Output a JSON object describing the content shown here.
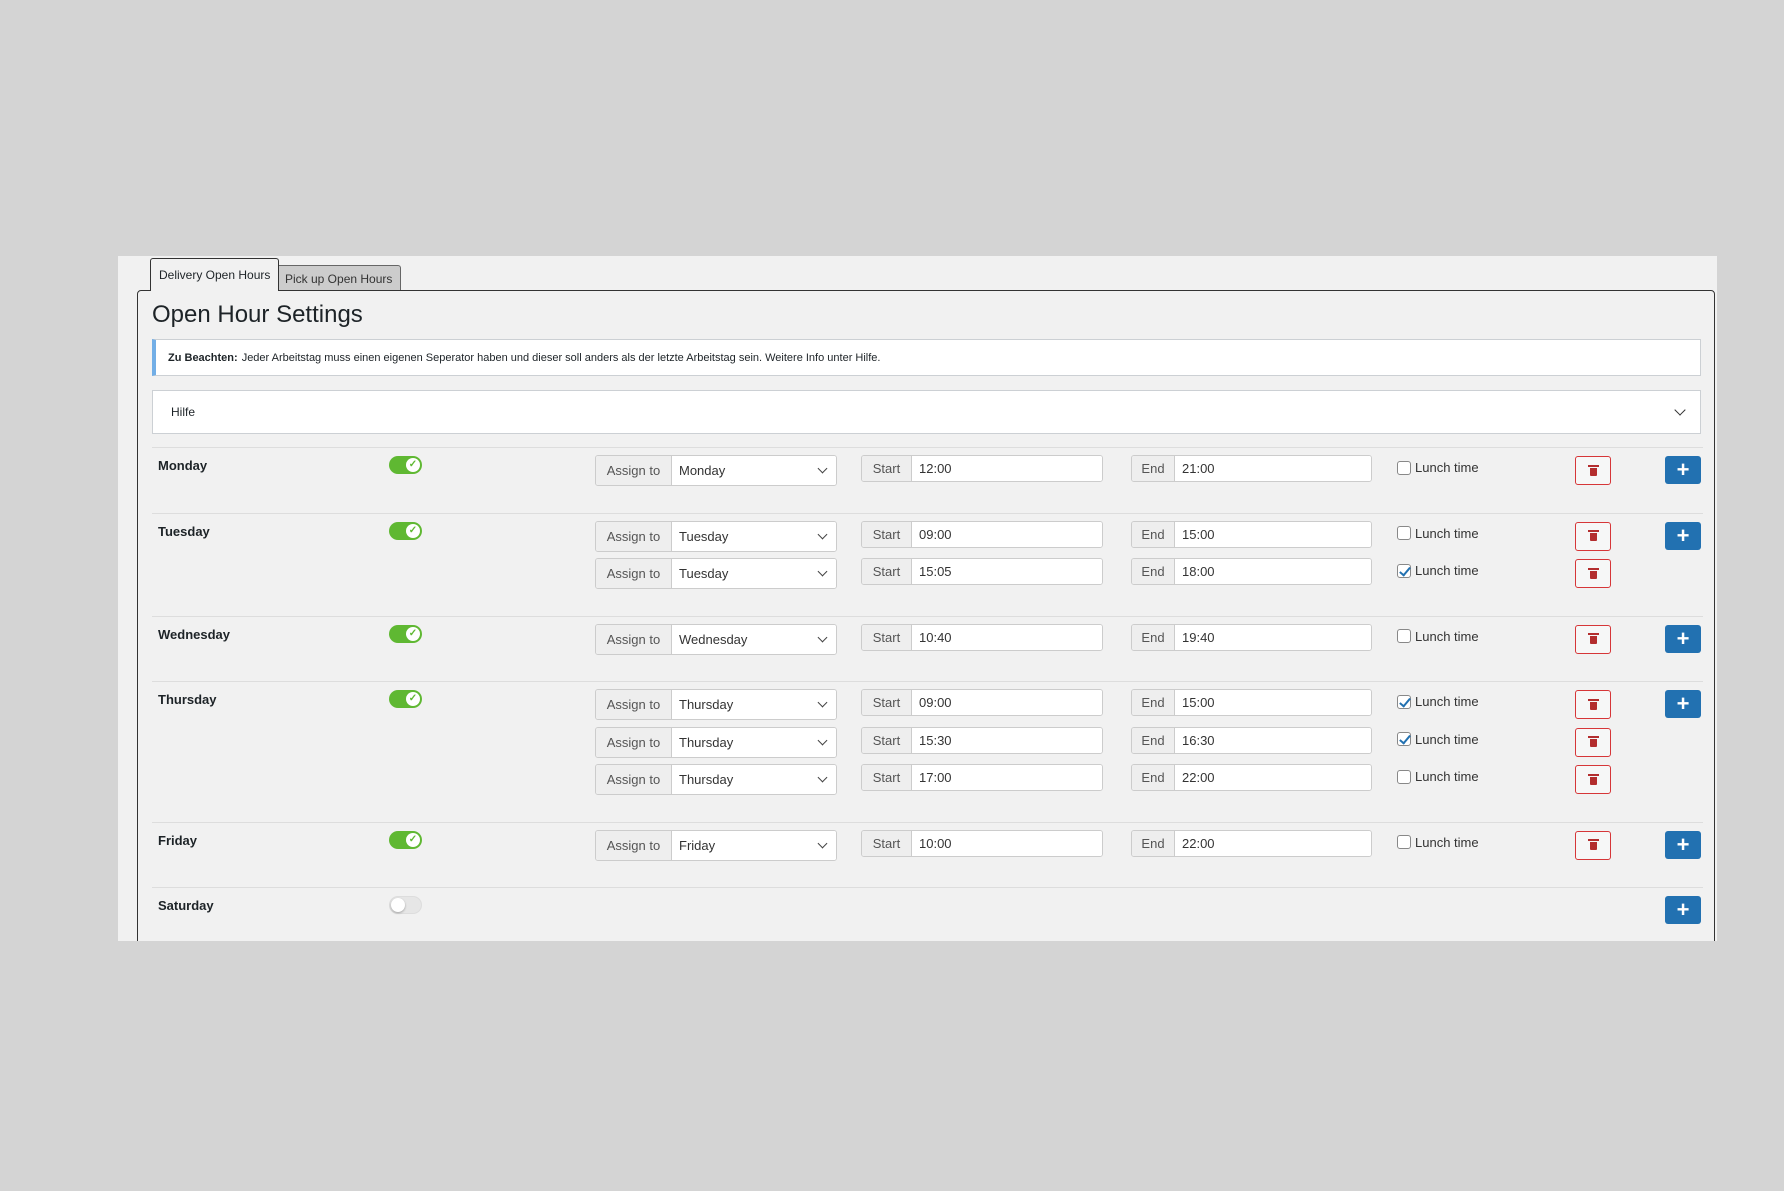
{
  "tabs": [
    {
      "label": "Delivery Open Hours",
      "active": true
    },
    {
      "label": "Pick up Open Hours",
      "active": false
    }
  ],
  "title": "Open Hour Settings",
  "notice": {
    "bold": "Zu Beachten:",
    "text": "Jeder Arbeitstag muss einen eigenen Seperator haben und dieser soll anders als der letzte Arbeitstag sein. Weitere Info unter Hilfe.",
    "accent": "#72aee6"
  },
  "hilfe": {
    "label": "Hilfe",
    "icon": "chevron-down-icon"
  },
  "labels": {
    "assign": "Assign to",
    "start": "Start",
    "end": "End",
    "lunch": "Lunch time",
    "add_icon": "+"
  },
  "colors": {
    "toggle_on": "#5fb832",
    "add_button": "#2271b1",
    "delete_border": "#d63638"
  },
  "days": [
    {
      "name": "Monday",
      "enabled": true,
      "slots": [
        {
          "assign": "Monday",
          "start": "12:00",
          "end": "21:00",
          "lunch": false
        }
      ]
    },
    {
      "name": "Tuesday",
      "enabled": true,
      "slots": [
        {
          "assign": "Tuesday",
          "start": "09:00",
          "end": "15:00",
          "lunch": false
        },
        {
          "assign": "Tuesday",
          "start": "15:05",
          "end": "18:00",
          "lunch": true
        }
      ]
    },
    {
      "name": "Wednesday",
      "enabled": true,
      "slots": [
        {
          "assign": "Wednesday",
          "start": "10:40",
          "end": "19:40",
          "lunch": false
        }
      ]
    },
    {
      "name": "Thursday",
      "enabled": true,
      "slots": [
        {
          "assign": "Thursday",
          "start": "09:00",
          "end": "15:00",
          "lunch": true
        },
        {
          "assign": "Thursday",
          "start": "15:30",
          "end": "16:30",
          "lunch": true
        },
        {
          "assign": "Thursday",
          "start": "17:00",
          "end": "22:00",
          "lunch": false
        }
      ]
    },
    {
      "name": "Friday",
      "enabled": true,
      "slots": [
        {
          "assign": "Friday",
          "start": "10:00",
          "end": "22:00",
          "lunch": false
        }
      ]
    },
    {
      "name": "Saturday",
      "enabled": false,
      "slots": []
    }
  ]
}
